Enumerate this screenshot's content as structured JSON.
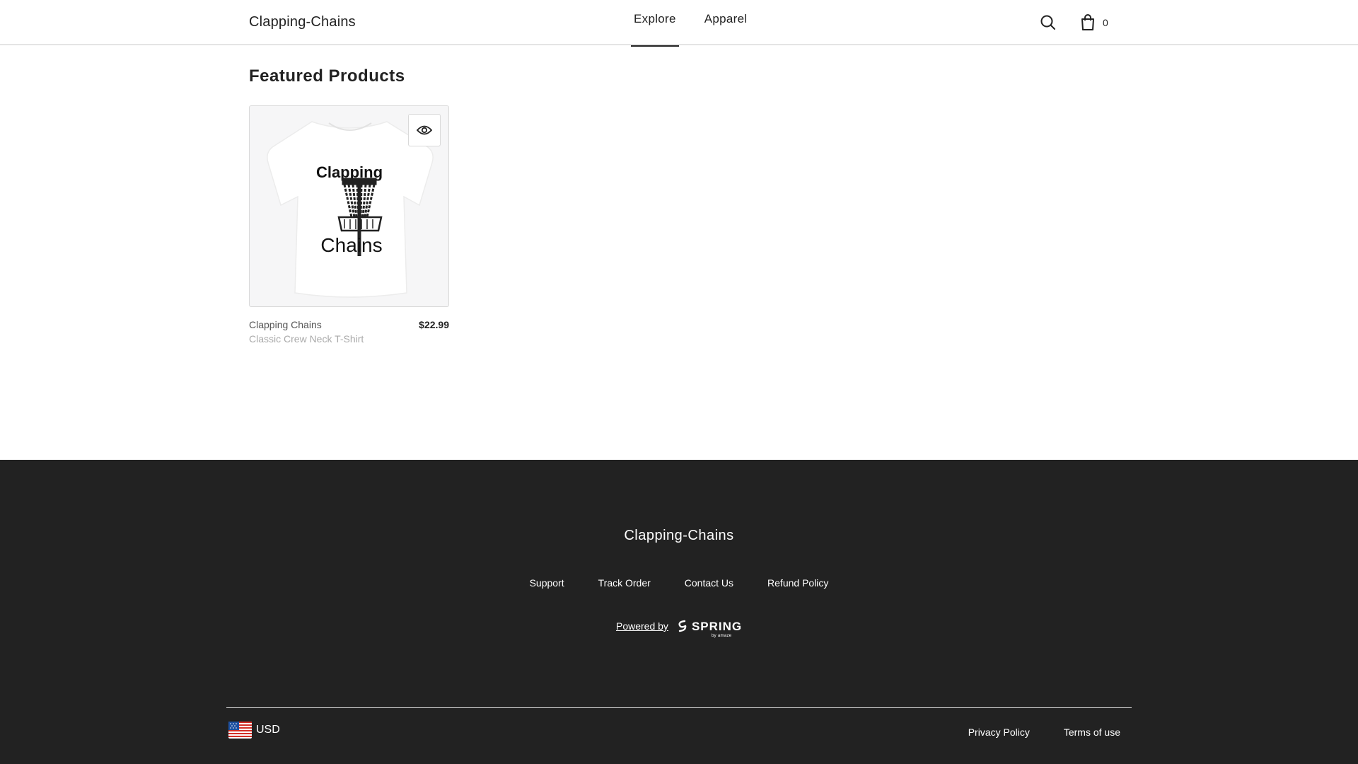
{
  "header": {
    "brand": "Clapping-Chains",
    "nav": [
      {
        "label": "Explore",
        "active": true
      },
      {
        "label": "Apparel",
        "active": false
      }
    ],
    "cart_count": "0"
  },
  "main": {
    "section_title": "Featured Products",
    "products": [
      {
        "name": "Clapping Chains",
        "variant": "Classic Crew Neck T-Shirt",
        "price": "$22.99",
        "print_top": "Clapping",
        "print_bottom": "Chains"
      }
    ]
  },
  "footer": {
    "brand": "Clapping-Chains",
    "links": [
      "Support",
      "Track Order",
      "Contact Us",
      "Refund Policy"
    ],
    "powered_by": "Powered by",
    "spring_logo": "SPRING",
    "spring_sub": "by amaze",
    "currency": "USD",
    "legal_links": [
      "Privacy Policy",
      "Terms of use"
    ]
  },
  "colors": {
    "footer_bg": "#222222",
    "card_bg": "#f6f6f7",
    "text": "#222222"
  }
}
